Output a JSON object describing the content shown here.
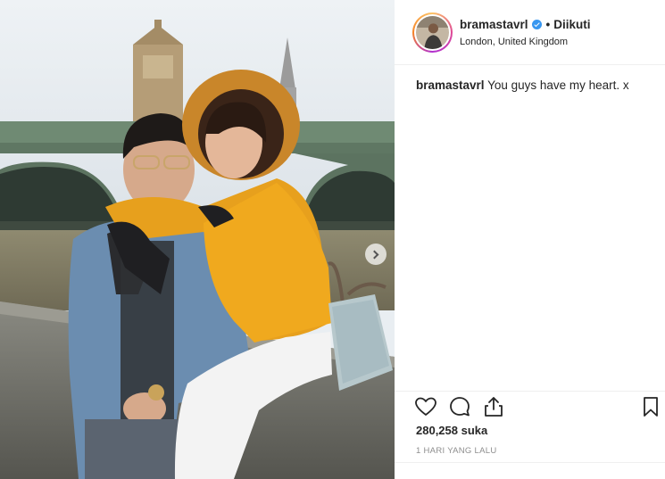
{
  "post": {
    "username": "bramastavrl",
    "verified": true,
    "separator": "•",
    "follow_state": "Diikuti",
    "location": "London, United Kingdom"
  },
  "caption": {
    "username": "bramastavrl",
    "text": "You guys have my heart. x"
  },
  "stats": {
    "likes": "280,258 suka",
    "timestamp": "1 HARI YANG LALU"
  },
  "icons": {
    "like": "heart-icon",
    "comment": "comment-icon",
    "share": "share-icon",
    "save": "bookmark-icon",
    "carousel_next": "chevron-right-icon",
    "verified": "verified-badge-icon"
  },
  "colors": {
    "verified_blue": "#3897f0",
    "text_primary": "#262626",
    "text_muted": "#8e8e8e",
    "divider": "#efefef"
  }
}
